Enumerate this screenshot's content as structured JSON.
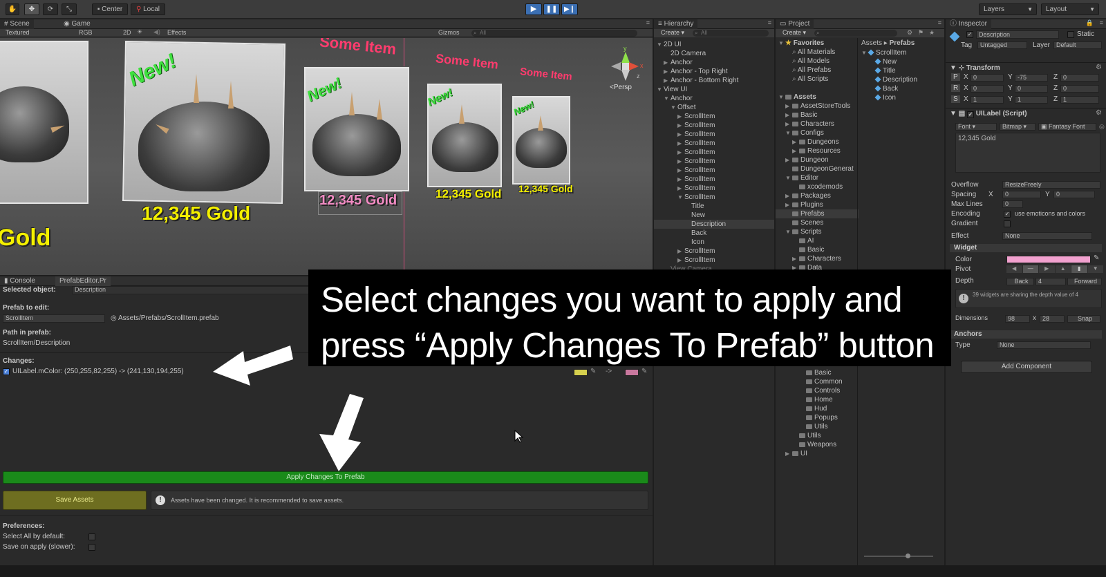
{
  "toolbar": {
    "center": "Center",
    "local": "Local",
    "layers": "Layers",
    "layout": "Layout"
  },
  "scene": {
    "tab_scene": "Scene",
    "tab_game": "Game",
    "textured": "Textured",
    "rgb": "RGB",
    "mode_2d": "2D",
    "effects": "Effects",
    "gizmos": "Gizmos",
    "search_placeholder": "All",
    "persp": "Persp",
    "gizmo_y": "y",
    "gizmo_x": "x",
    "gizmo_z": "z"
  },
  "viewport": {
    "item_gold": "12,345 Gold",
    "gold_partial": "Gold",
    "new_badge": "New!",
    "some_item": "Some Item"
  },
  "hierarchy": {
    "title": "Hierarchy",
    "create": "Create",
    "search_placeholder": "All",
    "items": [
      "2D UI",
      "2D Camera",
      "Anchor",
      "Anchor - Top Right",
      "Anchor - Bottom Right",
      "View UI",
      "Anchor",
      "Offset",
      "ScrollItem",
      "ScrollItem",
      "ScrollItem",
      "ScrollItem",
      "ScrollItem",
      "ScrollItem",
      "ScrollItem",
      "ScrollItem",
      "ScrollItem",
      "ScrollItem",
      "Title",
      "New",
      "Description",
      "Back",
      "Icon",
      "ScrollItem",
      "ScrollItem",
      "View Camera"
    ]
  },
  "project": {
    "title": "Project",
    "create": "Create",
    "favorites": "Favorites",
    "fav_items": [
      "All Materials",
      "All Models",
      "All Prefabs",
      "All Scripts"
    ],
    "assets": "Assets",
    "folders": [
      "AssetStoreTools",
      "Basic",
      "Characters",
      "Configs",
      "Dungeons",
      "Resources",
      "Dungeon",
      "DungeonGenerat",
      "Editor",
      "xcodemods",
      "Packages",
      "Plugins",
      "Prefabs",
      "Scenes",
      "Scripts",
      "AI",
      "Basic",
      "Characters",
      "Data"
    ],
    "lower_folders": [
      "Basic",
      "Common",
      "Controls",
      "Home",
      "Hud",
      "Popups",
      "Utils",
      "Utils",
      "Weapons",
      "UI"
    ],
    "breadcrumb_assets": "Assets",
    "breadcrumb_prefabs": "Prefabs",
    "prefab_tree": [
      "ScrollItem",
      "New",
      "Title",
      "Description",
      "Back",
      "Icon"
    ]
  },
  "inspector": {
    "title": "Inspector",
    "object_name": "Description",
    "static": "Static",
    "tag_label": "Tag",
    "tag_value": "Untagged",
    "layer_label": "Layer",
    "layer_value": "Default",
    "transform": "Transform",
    "p": "P",
    "r": "R",
    "s": "S",
    "x": "X",
    "y": "Y",
    "z": "Z",
    "pos": [
      "0",
      "-75",
      "0"
    ],
    "rot": [
      "0",
      "0",
      "0"
    ],
    "scale": [
      "1",
      "1",
      "1"
    ],
    "uilabel": "UILabel (Script)",
    "font": "Font",
    "bitmap": "Bitmap",
    "font_name": "Fantasy Font",
    "text_value": "12,345 Gold",
    "overflow_label": "Overflow",
    "overflow_value": "ResizeFreely",
    "spacing_label": "Spacing",
    "spacing_x": "0",
    "spacing_y": "0",
    "maxlines_label": "Max Lines",
    "maxlines_value": "0",
    "encoding_label": "Encoding",
    "encoding_value": "use emoticons and colors",
    "gradient_label": "Gradient",
    "effect_label": "Effect",
    "effect_value": "None",
    "widget": "Widget",
    "color_label": "Color",
    "color_value": "#f2a1cf",
    "pivot_label": "Pivot",
    "depth_label": "Depth",
    "back": "Back",
    "depth_value": "4",
    "forward": "Forward",
    "info": "39 widgets are sharing the depth value of 4",
    "dimensions_label": "Dimensions",
    "dim_w": "98",
    "dim_x": "x",
    "dim_h": "28",
    "snap": "Snap",
    "anchors": "Anchors",
    "type_label": "Type",
    "type_value": "None",
    "add_component": "Add Component"
  },
  "prefab_editor": {
    "tab_console": "Console",
    "tab_prefab": "PrefabEditor.Pr",
    "selected_label": "Selected object:",
    "selected_value": "Description",
    "prefab_label": "Prefab to edit:",
    "prefab_value": "ScrollItem",
    "prefab_path": "Assets/Prefabs/ScrollItem.prefab",
    "path_label": "Path in prefab:",
    "path_value": "ScrollItem/Description",
    "changes_label": "Changes:",
    "change_text": "UILabel.mColor: (250,255,82,255) -> (241,130,194,255)",
    "arrow": "->",
    "color_from": "#d6d04e",
    "color_to": "#c9789e",
    "apply": "Apply Changes To Prefab",
    "save": "Save Assets",
    "warning": "Assets have been changed. It is recommended to save assets.",
    "prefs_label": "Preferences:",
    "select_all": "Select All by default:",
    "save_on_apply": "Save on apply (slower):"
  },
  "overlay": {
    "line1": "Select changes you want to apply and",
    "line2": "press “Apply Changes To Prefab” button"
  }
}
